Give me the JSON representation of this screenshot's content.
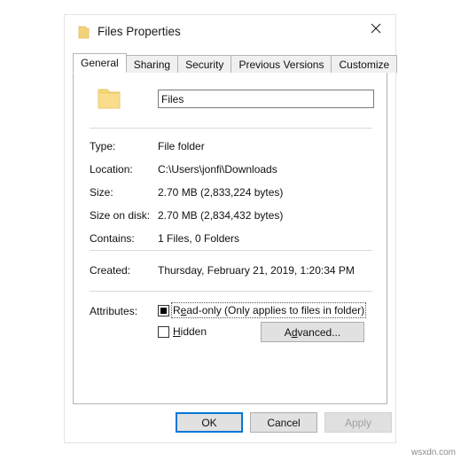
{
  "window": {
    "title": "Files Properties",
    "folder_icon": "folder-icon",
    "close_icon": "close-icon"
  },
  "tabs": [
    {
      "label": "General",
      "active": true
    },
    {
      "label": "Sharing",
      "active": false
    },
    {
      "label": "Security",
      "active": false
    },
    {
      "label": "Previous Versions",
      "active": false
    },
    {
      "label": "Customize",
      "active": false
    }
  ],
  "general": {
    "name_field": {
      "value": "Files",
      "placeholder": ""
    },
    "properties": [
      {
        "label": "Type:",
        "value": "File folder"
      },
      {
        "label": "Location:",
        "value": "C:\\Users\\jonfi\\Downloads"
      },
      {
        "label": "Size:",
        "value": "2.70 MB (2,833,224 bytes)"
      },
      {
        "label": "Size on disk:",
        "value": "2.70 MB (2,834,432 bytes)"
      },
      {
        "label": "Contains:",
        "value": "1 Files, 0 Folders"
      },
      {
        "label": "Created:",
        "value": "Thursday, February 21, 2019, 1:20:34 PM"
      }
    ],
    "attributes": {
      "label": "Attributes:",
      "readonly": {
        "label_prefix": "R",
        "label_accel": "e",
        "label_suffix": "ad-only (Only applies to files in folder)",
        "state": "indeterminate",
        "focused": true
      },
      "hidden": {
        "label_accel": "H",
        "label_suffix": "idden",
        "state": "unchecked",
        "focused": false
      },
      "advanced_button": {
        "prefix": "A",
        "accel": "d",
        "suffix": "vanced..."
      }
    }
  },
  "footer": {
    "ok_label": "OK",
    "cancel_label": "Cancel",
    "apply_label": "Apply",
    "apply_disabled": true
  },
  "watermark": "wsxdn.com",
  "colors": {
    "accent": "#0078d7",
    "folder_yellow": "#f7d775",
    "button_face": "#e1e1e1",
    "disabled_text": "#a0a0a0"
  }
}
